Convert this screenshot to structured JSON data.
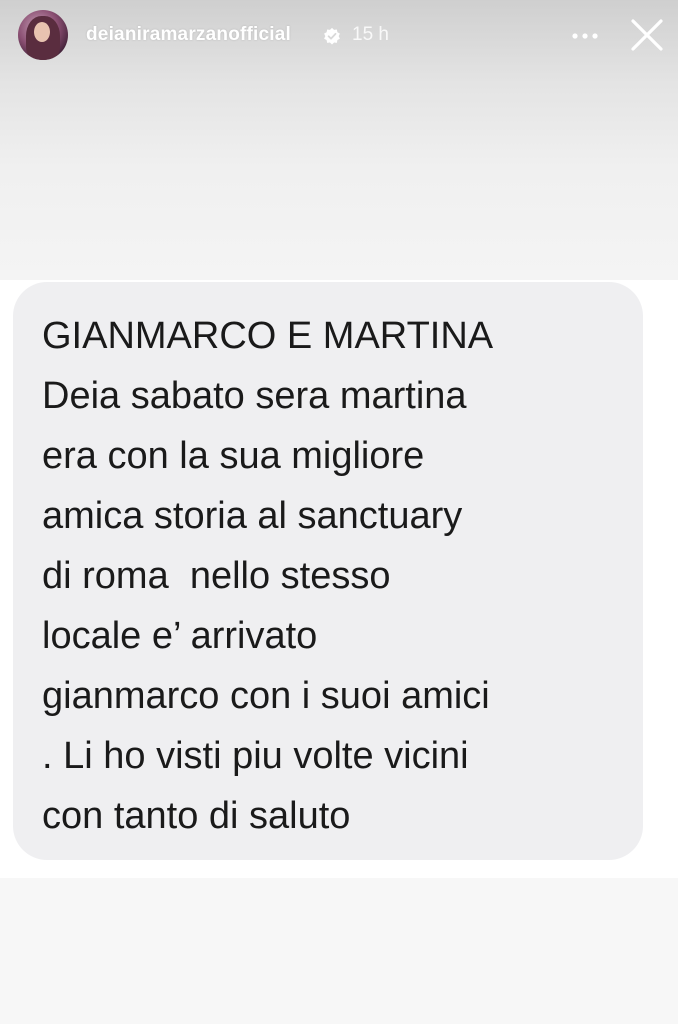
{
  "header": {
    "username": "deianiramarzanofficial",
    "time": "15 h",
    "avatar_icon": "avatar-photo",
    "verified_icon": "verified-badge-icon",
    "more_icon": "more-options-icon",
    "close_icon": "close-icon"
  },
  "message": {
    "text": "GIANMARCO E MARTINA\nDeia sabato sera martina\nera con la sua migliore\namica storia al sanctuary\ndi roma  nello stesso\nlocale e’ arrivato\ngianmarco con i suoi amici\n. Li ho visti piu volte vicini\ncon tanto di saluto"
  },
  "colors": {
    "bubble": "#efeff1",
    "text": "#1a1a1a",
    "header_text": "#ffffff"
  }
}
